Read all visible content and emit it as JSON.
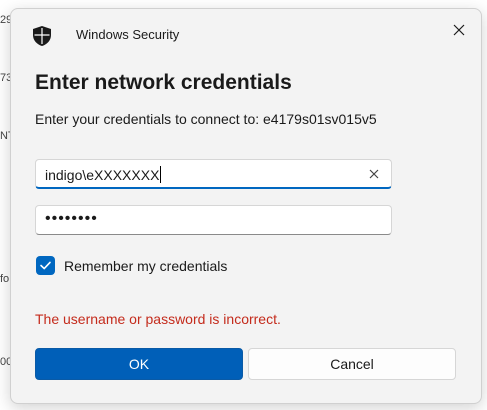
{
  "background": {
    "fragments": [
      "29",
      "73",
      "NT",
      "fo",
      "00"
    ]
  },
  "dialog": {
    "app_title": "Windows Security",
    "heading": "Enter network credentials",
    "subtext": "Enter your credentials to connect to: e4179s01sv015v5",
    "username": {
      "value": "indigo\\eXXXXXXX"
    },
    "password": {
      "masked_value": "••••••••"
    },
    "remember": {
      "label": "Remember my credentials",
      "checked": true
    },
    "error": "The username or password is incorrect.",
    "ok_label": "OK",
    "cancel_label": "Cancel"
  },
  "colors": {
    "accent": "#005fb8",
    "error": "#c42b1c",
    "dialog_bg": "#f3f3f3"
  },
  "icons": {
    "title": "shield-icon",
    "close": "close-icon",
    "clear": "clear-icon",
    "check": "checkmark-icon"
  }
}
